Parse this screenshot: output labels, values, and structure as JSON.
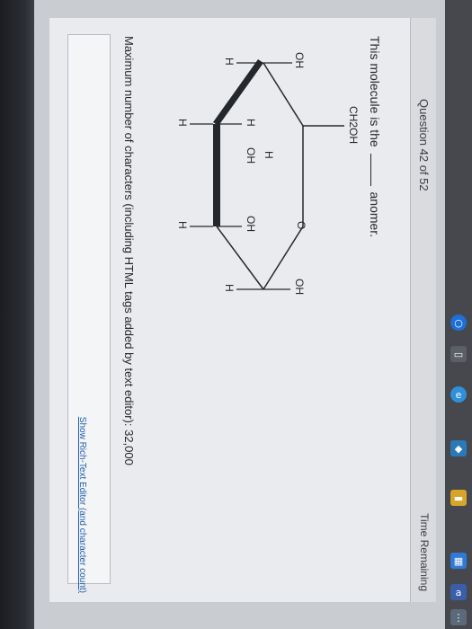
{
  "header": {
    "question_counter": "Question 42 of 52",
    "time_remaining": "Time Remaining"
  },
  "question": {
    "prompt_before": "This molecule is the",
    "prompt_after": "anomer.",
    "substituent_top": "CH2OH",
    "labels": {
      "left_oh": "OH",
      "left_h": "H",
      "c4_h": "H",
      "c4_oh": "OH",
      "ring_o": "O",
      "c3_oh": "OH",
      "c2_h": "H",
      "right_oh": "OH",
      "right_h": "H",
      "bottom_h1": "H",
      "bottom_h2": "H"
    }
  },
  "editor": {
    "max_chars_text": "Maximum number of characters (including HTML tags added by text editor): 32,000",
    "rich_text_link": "Show Rich-Text Editor (and character count)"
  },
  "taskbar": {
    "icons": [
      "circle-icon",
      "window-icon",
      "browser-icon",
      "app-icon",
      "folder-icon",
      "store-icon",
      "a-icon",
      "dots-icon"
    ]
  },
  "colors": {
    "accent": "#1f5fa8",
    "background": "#e9ebee"
  }
}
